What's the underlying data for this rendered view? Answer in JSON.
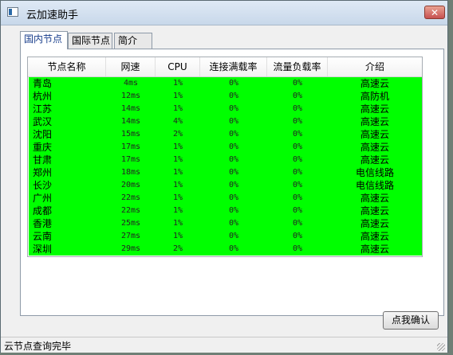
{
  "window": {
    "title": "云加速助手",
    "close_glyph": "✕"
  },
  "tabs": [
    {
      "label": "国内节点",
      "active": true
    },
    {
      "label": "国际节点",
      "active": false
    },
    {
      "label": "简介",
      "active": false
    }
  ],
  "table": {
    "columns": [
      "节点名称",
      "网速",
      "CPU",
      "连接满载率",
      "流量负载率",
      "介绍"
    ],
    "row_bg_color": "#00ff00",
    "rows": [
      [
        "青岛",
        "4ms",
        "1%",
        "0%",
        "0%",
        "高速云"
      ],
      [
        "杭州",
        "12ms",
        "1%",
        "0%",
        "0%",
        "高防机"
      ],
      [
        "江苏",
        "14ms",
        "1%",
        "0%",
        "0%",
        "高速云"
      ],
      [
        "武汉",
        "14ms",
        "4%",
        "0%",
        "0%",
        "高速云"
      ],
      [
        "沈阳",
        "15ms",
        "2%",
        "0%",
        "0%",
        "高速云"
      ],
      [
        "重庆",
        "17ms",
        "1%",
        "0%",
        "0%",
        "高速云"
      ],
      [
        "甘肃",
        "17ms",
        "1%",
        "0%",
        "0%",
        "高速云"
      ],
      [
        "郑州",
        "18ms",
        "1%",
        "0%",
        "0%",
        "电信线路"
      ],
      [
        "长沙",
        "20ms",
        "1%",
        "0%",
        "0%",
        "电信线路"
      ],
      [
        "广州",
        "22ms",
        "1%",
        "0%",
        "0%",
        "高速云"
      ],
      [
        "成都",
        "22ms",
        "1%",
        "0%",
        "0%",
        "高速云"
      ],
      [
        "香港",
        "25ms",
        "1%",
        "0%",
        "0%",
        "高速云"
      ],
      [
        "云南",
        "27ms",
        "1%",
        "0%",
        "0%",
        "高速云"
      ],
      [
        "深圳",
        "29ms",
        "2%",
        "0%",
        "0%",
        "高速云"
      ]
    ]
  },
  "buttons": {
    "confirm": "点我确认"
  },
  "status": {
    "text": "云节点查询完毕"
  }
}
